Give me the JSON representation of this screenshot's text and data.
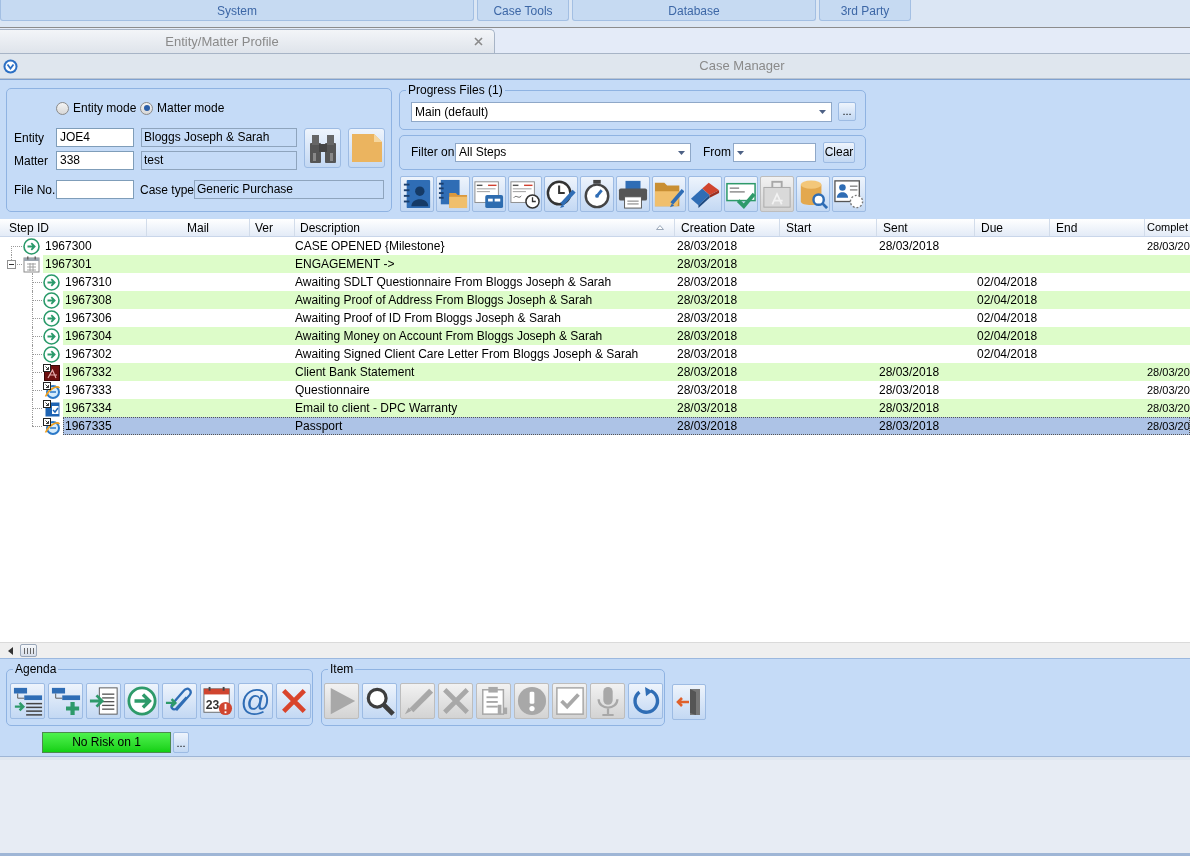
{
  "ribbon": {
    "groups": [
      "System",
      "Case Tools",
      "Database",
      "3rd Party"
    ]
  },
  "tabs": [
    {
      "label": "Entity/Matter Profile",
      "selected": false
    }
  ],
  "window": {
    "title": "Case Manager"
  },
  "modes": [
    {
      "label": "Entity mode",
      "selected": false
    },
    {
      "label": "Matter mode",
      "selected": true
    }
  ],
  "entity": {
    "label": "Entity",
    "code": "JOE4",
    "name": "Bloggs Joseph & Sarah"
  },
  "matter": {
    "label": "Matter",
    "code": "338",
    "name": "test"
  },
  "file_no": {
    "label": "File No."
  },
  "case_type": {
    "label": "Case type",
    "value": "Generic Purchase"
  },
  "progress_files": {
    "legend": "Progress Files (1)",
    "value": "Main (default)",
    "more": "..."
  },
  "filter": {
    "label": "Filter on",
    "value": "All Steps",
    "from_label": "From",
    "clear": "Clear"
  },
  "toolbar": [
    {
      "disabled": false
    },
    {
      "disabled": false
    },
    {
      "disabled": false
    },
    {
      "disabled": false
    },
    {
      "disabled": false
    },
    {
      "disabled": false
    },
    {
      "disabled": false
    },
    {
      "disabled": false
    },
    {
      "disabled": false
    },
    {
      "disabled": false
    },
    {
      "disabled": true
    },
    {
      "disabled": false
    },
    {
      "disabled": false
    }
  ],
  "table": {
    "columns": [
      {
        "label": "Step ID",
        "sorted": false
      },
      {
        "label": "Mail",
        "sorted": false
      },
      {
        "label": "Ver",
        "sorted": false
      },
      {
        "label": "Description",
        "sorted": true
      },
      {
        "label": "Creation Date",
        "sorted": false
      },
      {
        "label": "Start",
        "sorted": false
      },
      {
        "label": "Sent",
        "sorted": false
      },
      {
        "label": "Due",
        "sorted": false
      },
      {
        "label": "End",
        "sorted": false
      },
      {
        "label": "Complet",
        "sorted": false
      }
    ],
    "rows": [
      {
        "kind": "action",
        "step_id": "1967300",
        "description": "CASE OPENED {Milestone}",
        "creation_date": "28/03/2018",
        "sent": "28/03/2018",
        "complete": "28/03/20",
        "selected": false
      },
      {
        "kind": "group",
        "step_id": "1967301",
        "description": "ENGAGEMENT ->",
        "creation_date": "28/03/2018",
        "selected": false,
        "expanded": true,
        "children": [
          {
            "kind": "action",
            "step_id": "1967310",
            "description": "Awaiting SDLT Questionnaire From Bloggs Joseph & Sarah",
            "creation_date": "28/03/2018",
            "due": "02/04/2018",
            "selected": false
          },
          {
            "kind": "action",
            "step_id": "1967308",
            "description": "Awaiting Proof of Address From Bloggs Joseph & Sarah",
            "creation_date": "28/03/2018",
            "due": "02/04/2018",
            "selected": false
          },
          {
            "kind": "action",
            "step_id": "1967306",
            "description": "Awaiting Proof of ID From Bloggs Joseph & Sarah",
            "creation_date": "28/03/2018",
            "due": "02/04/2018",
            "selected": false
          },
          {
            "kind": "action",
            "step_id": "1967304",
            "description": "Awaiting Money on Account From Bloggs Joseph & Sarah",
            "creation_date": "28/03/2018",
            "due": "02/04/2018",
            "selected": false
          },
          {
            "kind": "action",
            "step_id": "1967302",
            "description": "Awaiting Signed Client Care Letter From Bloggs Joseph & Sarah",
            "creation_date": "28/03/2018",
            "due": "02/04/2018",
            "selected": false
          },
          {
            "kind": "pdf",
            "step_id": "1967332",
            "description": "Client Bank Statement",
            "creation_date": "28/03/2018",
            "sent": "28/03/2018",
            "complete": "28/03/20",
            "selected": false
          },
          {
            "kind": "web",
            "step_id": "1967333",
            "description": "Questionnaire",
            "creation_date": "28/03/2018",
            "sent": "28/03/2018",
            "complete": "28/03/20",
            "selected": false
          },
          {
            "kind": "email",
            "step_id": "1967334",
            "description": "Email to client - DPC Warranty",
            "creation_date": "28/03/2018",
            "sent": "28/03/2018",
            "complete": "28/03/20",
            "selected": false
          },
          {
            "kind": "web",
            "step_id": "1967335",
            "description": "Passport",
            "creation_date": "28/03/2018",
            "sent": "28/03/2018",
            "complete": "28/03/20",
            "selected": true
          }
        ]
      }
    ]
  },
  "agenda": {
    "legend": "Agenda",
    "calendar_day": "23",
    "at_sign": "@"
  },
  "item": {
    "legend": "Item",
    "buttons": [
      {
        "disabled": true
      },
      {
        "disabled": false
      },
      {
        "disabled": true
      },
      {
        "disabled": true
      },
      {
        "disabled": true
      },
      {
        "disabled": true
      },
      {
        "disabled": true
      },
      {
        "disabled": true
      },
      {
        "disabled": false
      }
    ]
  },
  "risk": {
    "label": "No Risk on 1",
    "more": "..."
  }
}
